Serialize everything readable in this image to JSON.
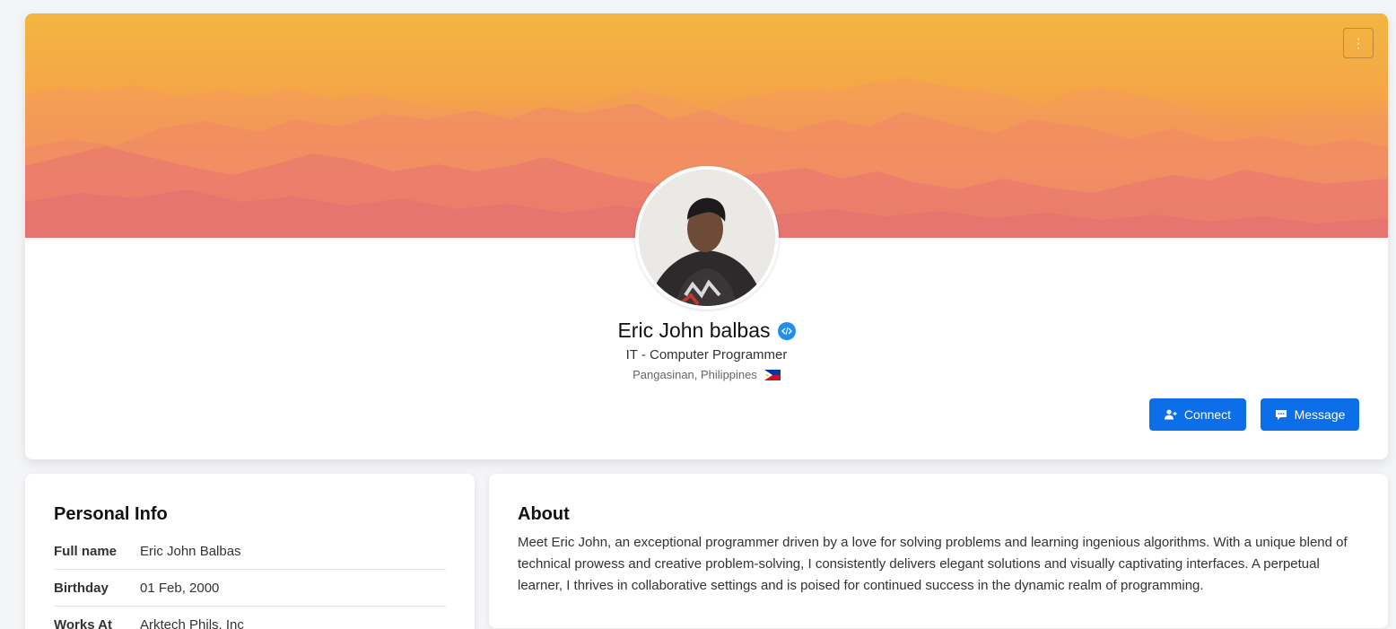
{
  "profile": {
    "name": "Eric John balbas",
    "title": "IT - Computer Programmer",
    "location": "Pangasinan, Philippines",
    "verified_badge_icon": "code-badge-icon",
    "flag_icon": "philippines-flag-icon"
  },
  "actions": {
    "more_icon": "kebab-menu-icon",
    "connect_label": "Connect",
    "connect_icon": "user-plus-icon",
    "message_label": "Message",
    "message_icon": "chat-bubble-icon"
  },
  "personal_info": {
    "heading": "Personal Info",
    "rows": [
      {
        "label": "Full name",
        "value": "Eric John Balbas"
      },
      {
        "label": "Birthday",
        "value": "01 Feb, 2000"
      },
      {
        "label": "Works At",
        "value": "Arktech Phils. Inc"
      }
    ]
  },
  "about": {
    "heading": "About",
    "text": "Meet Eric John, an exceptional programmer driven by a love for solving problems and learning ingenious algorithms. With a unique blend of technical prowess and creative problem-solving, I consistently delivers elegant solutions and visually captivating interfaces. A perpetual learner, I thrives in collaborative settings and is poised for continued success in the dynamic realm of programming."
  },
  "colors": {
    "primary": "#0d6ee9",
    "verified": "#1f8ef1",
    "cover_top": "#f2b640",
    "cover_bottom": "#ee8370"
  }
}
